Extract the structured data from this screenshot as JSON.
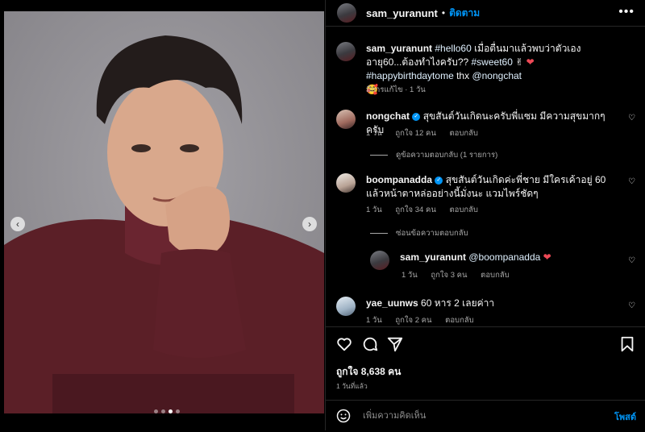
{
  "post_author": "sam_yuranunt",
  "header": {
    "username": "sam_yuranunt",
    "separator": "•",
    "follow_label": "ติดตาม",
    "more_label": "•••"
  },
  "media": {
    "prev_label": "‹",
    "next_label": "›",
    "slide_count": 4,
    "active_slide": 3
  },
  "caption": {
    "username": "sam_yuranunt",
    "text_1": "#hello60",
    "text_2": " เมื่อตื่นมาแล้วพบว่าตัวเองอายุ60...ต้องทำไงครับ?? ",
    "text_3": "#sweet60",
    "text_4": " ✌ ",
    "text_5": "❤",
    "text_6": " ",
    "text_7": "#happybirthdaytome",
    "text_8": " thx ",
    "text_9": "@nongchat",
    "text_10": "🥰",
    "meta": "มีการแก้ไข · 1 วัน"
  },
  "comments": [
    {
      "username": "nongchat",
      "text": "สุขสันต์วันเกิดนะครับพี่แซม มีความสุขมากๆครับ",
      "age": "1 วัน",
      "likes": "ถูกใจ 12 คน",
      "reply_label": "ตอบกลับ",
      "view_replies": "ดูข้อความตอบกลับ (1 รายการ)"
    },
    {
      "username": "boompanadda",
      "text": "สุขสันต์วันเกิดค่ะพี่ชาย มีใครเค้าอยู่ 60 แล้วหน้าตาหล่ออย่างนี้มั่งนะ แวมไพร์ชัดๆ",
      "age": "1 วัน",
      "likes": "ถูกใจ 34 คน",
      "reply_label": "ตอบกลับ",
      "hide_replies": "ซ่อนข้อความตอบกลับ"
    },
    {
      "username": "sam_yuranunt",
      "text": "@boompanadda",
      "heart": "❤",
      "age": "1 วัน",
      "likes": "ถูกใจ 3 คน",
      "reply_label": "ตอบกลับ"
    },
    {
      "username": "yae_uunws",
      "text": "60 หาร 2 เลยค่าา",
      "age": "1 วัน",
      "likes": "ถูกใจ 2 คน",
      "reply_label": "ตอบกลับ"
    }
  ],
  "footer": {
    "likes": "ถูกใจ 8,638 คน",
    "time": "1 วันที่แล้ว",
    "comment_placeholder": "เพิ่มความคิดเห็น",
    "post_label": "โพสต์"
  },
  "icons": [
    "heart-icon",
    "comment-icon",
    "share-icon",
    "bookmark-icon",
    "emoji-icon",
    "more-icon",
    "verified-icon"
  ],
  "colors": {
    "accent": "#0095f6",
    "background": "#000000",
    "muted": "#a8a8a8",
    "like_red": "#ed4956"
  }
}
